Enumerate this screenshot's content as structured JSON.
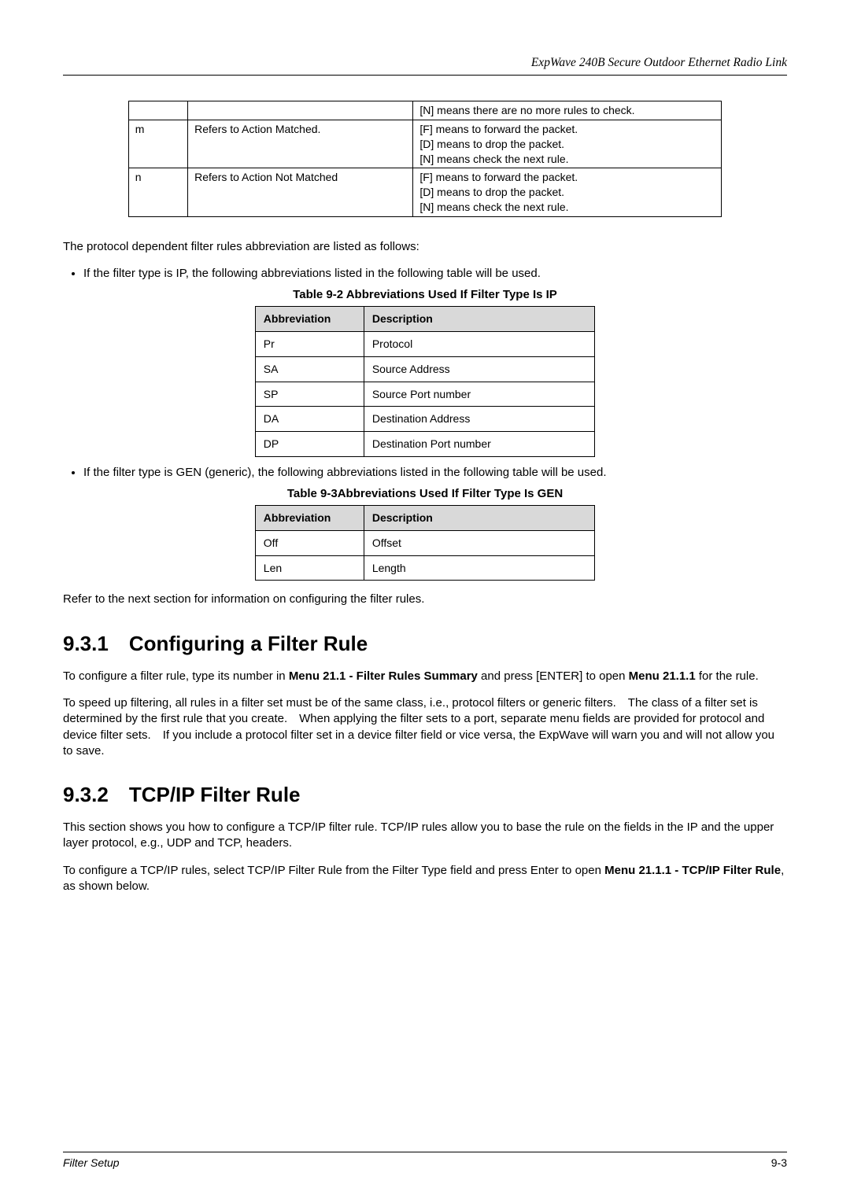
{
  "header_title": "ExpWave 240B Secure Outdoor Ethernet Radio Link",
  "table1": {
    "rows": [
      {
        "col1": "",
        "col2": "",
        "col3": "[N] means there are no more rules to check."
      },
      {
        "col1": "m",
        "col2": "Refers to Action Matched.",
        "col3_lines": [
          "[F] means to forward the packet.",
          "[D] means to drop the packet.",
          "[N] means check the next rule."
        ]
      },
      {
        "col1": "n",
        "col2": "Refers to Action Not Matched",
        "col3_lines": [
          "[F] means to forward the packet.",
          "[D] means to drop the packet.",
          "[N] means check the next rule."
        ]
      }
    ]
  },
  "para_protocol": "The protocol dependent filter rules abbreviation are listed as follows:",
  "bullet_ip": "If the filter type is IP, the following abbreviations listed in the following table will be used.",
  "caption_ip": "Table 9-2 Abbreviations Used If Filter Type Is IP",
  "table_ip": {
    "head_abbr": "Abbreviation",
    "head_desc": "Description",
    "rows": [
      {
        "abbr": "Pr",
        "desc": "Protocol"
      },
      {
        "abbr": "SA",
        "desc": "Source Address"
      },
      {
        "abbr": "SP",
        "desc": "Source Port number"
      },
      {
        "abbr": "DA",
        "desc": "Destination Address"
      },
      {
        "abbr": "DP",
        "desc": "Destination Port number"
      }
    ]
  },
  "bullet_gen": "If the filter type is GEN (generic), the following abbreviations listed in the following table will be used.",
  "caption_gen": "Table 9-3Abbreviations Used If Filter Type Is GEN",
  "table_gen": {
    "head_abbr": "Abbreviation",
    "head_desc": "Description",
    "rows": [
      {
        "abbr": "Off",
        "desc": "Offset"
      },
      {
        "abbr": "Len",
        "desc": "Length"
      }
    ]
  },
  "para_refernext": "Refer to the next section for information on configuring the filter rules.",
  "sec_931_title": "9.3.1 Configuring a Filter Rule",
  "sec_931_p1_a": "To configure a filter rule, type its number in ",
  "sec_931_p1_bold1": "Menu 21.1 - Filter Rules Summary",
  "sec_931_p1_b": " and press [ENTER] to open ",
  "sec_931_p1_bold2": "Menu 21.1.1",
  "sec_931_p1_c": " for the rule.",
  "sec_931_p2": "To speed up filtering, all rules in a filter set must be of the same class, i.e., protocol filters or generic filters. The class of a filter set is determined by the first rule that you create. When applying the filter sets to a port, separate menu fields are provided for protocol and device filter sets. If you include a protocol filter set in a device filter field or vice versa, the ExpWave will warn you and will not allow you to save.",
  "sec_932_title": "9.3.2 TCP/IP Filter Rule",
  "sec_932_p1": "This section shows you how to configure a TCP/IP filter rule. TCP/IP rules allow you to base the rule on the fields in the IP and the upper layer protocol, e.g., UDP and TCP, headers.",
  "sec_932_p2_a": "To configure a TCP/IP rules, select TCP/IP Filter Rule from the Filter Type field and press Enter to open ",
  "sec_932_p2_bold": "Menu 21.1.1 - TCP/IP Filter Rule",
  "sec_932_p2_b": ", as shown below.",
  "footer_left": "Filter Setup",
  "footer_right": "9-3"
}
